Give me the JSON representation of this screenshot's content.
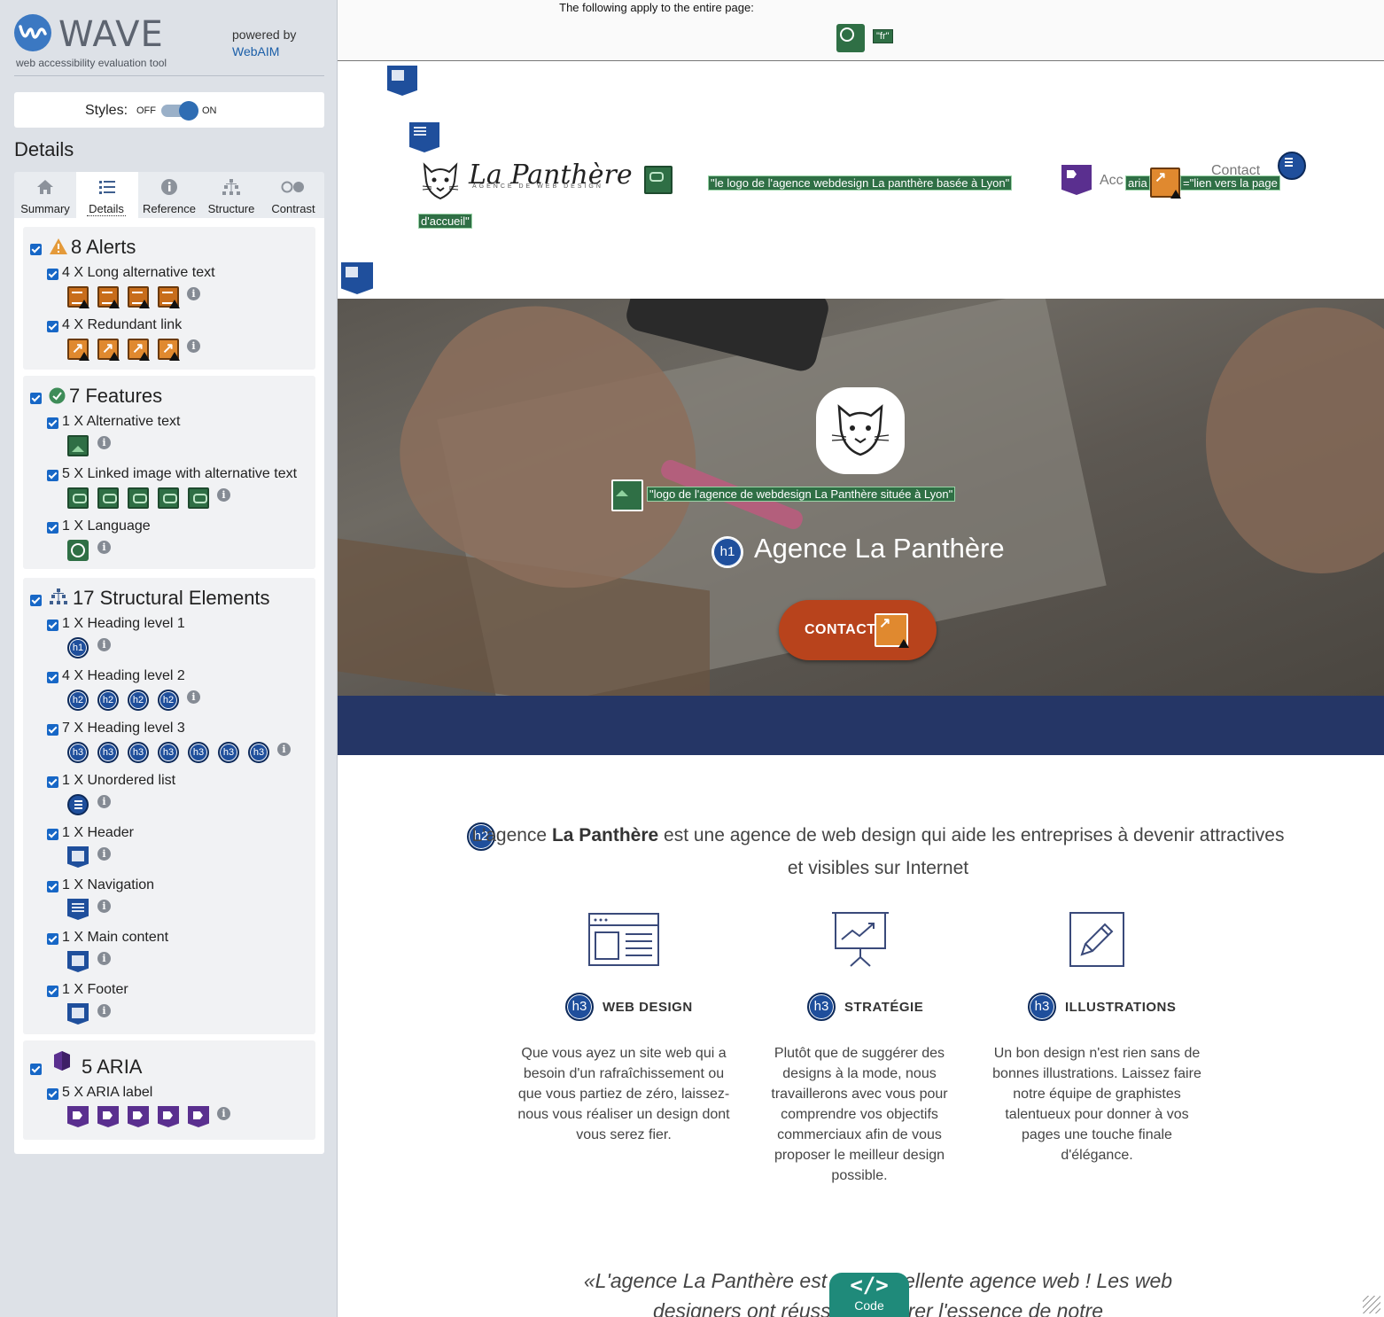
{
  "wave": {
    "brand": "WAVE",
    "subtitle": "web accessibility evaluation tool",
    "powered_by": "powered by",
    "webaim": "WebAIM",
    "styles_label": "Styles:",
    "styles_off": "OFF",
    "styles_on": "ON",
    "styles_enabled": true,
    "details_title": "Details",
    "tabs": [
      {
        "label": "Summary",
        "icon": "home-icon"
      },
      {
        "label": "Details",
        "icon": "list-icon",
        "active": true
      },
      {
        "label": "Reference",
        "icon": "info-icon"
      },
      {
        "label": "Structure",
        "icon": "hierarchy-icon"
      },
      {
        "label": "Contrast",
        "icon": "contrast-icon"
      }
    ],
    "alerts": {
      "title": "8 Alerts",
      "items": [
        {
          "label": "4 X Long alternative text",
          "count": 4,
          "icon": "long-alt-icon"
        },
        {
          "label": "4 X Redundant link",
          "count": 4,
          "icon": "redundant-link-icon"
        }
      ]
    },
    "features": {
      "title": "7 Features",
      "items": [
        {
          "label": "1 X Alternative text",
          "count": 1,
          "icon": "alt-text-icon"
        },
        {
          "label": "5 X Linked image with alternative text",
          "count": 5,
          "icon": "linked-image-icon"
        },
        {
          "label": "1 X Language",
          "count": 1,
          "icon": "language-icon"
        }
      ]
    },
    "structure": {
      "title": "17 Structural Elements",
      "items": [
        {
          "label": "1 X Heading level 1",
          "count": 1,
          "icon": "h1"
        },
        {
          "label": "4 X Heading level 2",
          "count": 4,
          "icon": "h2"
        },
        {
          "label": "7 X Heading level 3",
          "count": 7,
          "icon": "h3"
        },
        {
          "label": "1 X Unordered list",
          "count": 1,
          "icon": "list-icon"
        },
        {
          "label": "1 X Header",
          "count": 1,
          "icon": "header-icon"
        },
        {
          "label": "1 X Navigation",
          "count": 1,
          "icon": "navigation-icon"
        },
        {
          "label": "1 X Main content",
          "count": 1,
          "icon": "main-icon"
        },
        {
          "label": "1 X Footer",
          "count": 1,
          "icon": "footer-icon"
        }
      ]
    },
    "aria": {
      "title": "5 ARIA",
      "items": [
        {
          "label": "5 X ARIA label",
          "count": 5,
          "icon": "aria-label-icon"
        }
      ]
    },
    "info_symbol": "i"
  },
  "page": {
    "doc_notice": "The following apply to the entire page:",
    "lang_tag": "\"fr\"",
    "logo_title": "La Panthère",
    "logo_subtitle": "AGENCE DE WEB DESIGN",
    "alt_logo_header": "\"le logo de l'agence webdesign La panthère basée à Lyon\"",
    "nav_accueil_fragment": "Acc",
    "nav_label_fragment": "aria",
    "aria_link_label": "=\"lien vers la page",
    "aria_link_label_cont": "d'accueil\"",
    "nav_contact": "Contact",
    "hero_alt": "\"logo de l'agence de webdesign La Panthère située à Lyon\"",
    "hero_h1": "Agence La Panthère",
    "contact_button": "CONTACT",
    "intro_pre": "L'agence",
    "intro_bold": "La Panthère",
    "intro_post": "est une agence de web design qui aide les entreprises à devenir attractives et visibles sur Internet",
    "services": [
      {
        "title": "WEB DESIGN",
        "icon": "browser-window-icon",
        "text": "Que vous ayez un site web qui a besoin d'un rafraîchissement ou que vous partiez de zéro, laissez-nous vous réaliser un design dont vous serez fier."
      },
      {
        "title": "STRATÉGIE",
        "icon": "presentation-chart-icon",
        "text": "Plutôt que de suggérer des designs à la mode, nous travaillerons avec vous pour comprendre vos objectifs commerciaux afin de vous proposer le meilleur design possible."
      },
      {
        "title": "ILLUSTRATIONS",
        "icon": "pencil-edit-icon",
        "text": "Un bon design n'est rien sans de bonnes illustrations. Laissez faire notre équipe de graphistes talentueux pour donner à vos pages une touche finale d'élégance."
      }
    ],
    "quote": "«L'agence La Panthère est une excellente agence web ! Les web designers ont réussi à capturer l'essence de notre",
    "code_glyph": "</>",
    "code_label": "Code",
    "h1_tag": "h1",
    "h2_tag": "h2",
    "h3_tag": "h3"
  },
  "colors": {
    "sidebar_bg": "#dde1e7",
    "feature_green": "#2f6f45",
    "alert_orange": "#c86d1b",
    "structure_blue": "#1f4f9c",
    "aria_purple": "#5a2f8f",
    "hero_blue_bar": "#253666",
    "contact_btn": "#b8431c",
    "code_btn": "#1f8a7a"
  }
}
